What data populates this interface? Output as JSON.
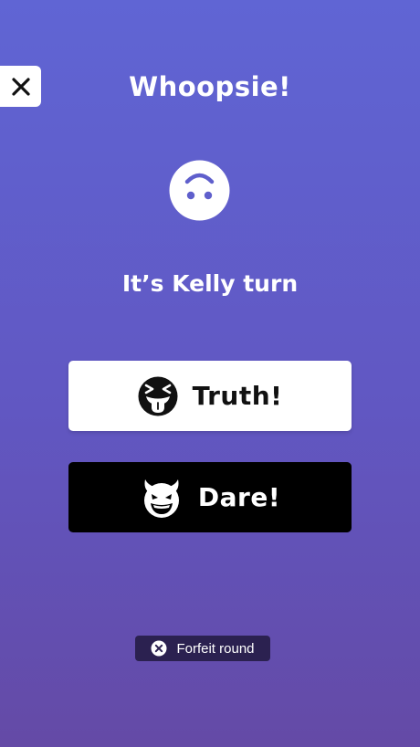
{
  "title": "Whoopsie!",
  "turn_text": "It’s Kelly turn",
  "buttons": {
    "truth_label": "Truth!",
    "dare_label": "Dare!",
    "forfeit_label": "Forfeit round"
  },
  "icons": {
    "close": "close-icon",
    "face": "upside-down-face-icon",
    "truth": "squinting-tongue-face-icon",
    "dare": "smiling-devil-face-icon",
    "forfeit": "x-circle-icon"
  },
  "colors": {
    "background_top": "#6065d4",
    "background_bottom": "#644aa6",
    "truth_bg": "#ffffff",
    "dare_bg": "#000000",
    "forfeit_bg": "#2b2150"
  }
}
